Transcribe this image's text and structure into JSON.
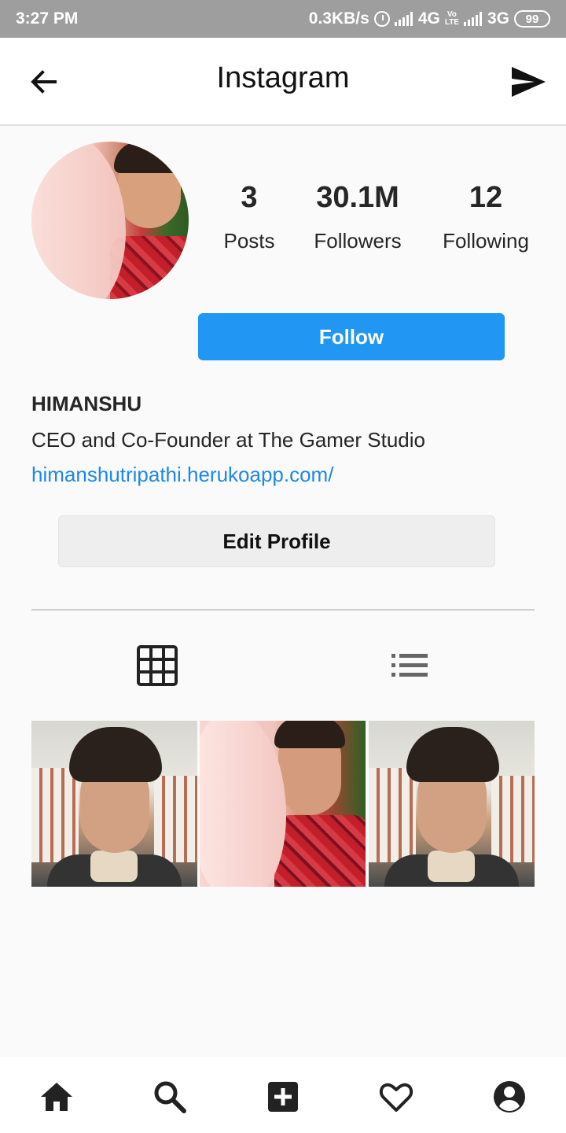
{
  "status_bar": {
    "time": "3:27 PM",
    "net_speed": "0.3KB/s",
    "network1": "4G",
    "volte_top": "Vo",
    "volte_bottom": "LTE",
    "network2": "3G",
    "battery": "99"
  },
  "header": {
    "title": "Instagram"
  },
  "profile": {
    "posts_count": "3",
    "posts_label": "Posts",
    "followers_count": "30.1M",
    "followers_label": "Followers",
    "following_count": "12",
    "following_label": "Following",
    "follow_label": "Follow",
    "name": "HIMANSHU",
    "bio": "CEO and Co-Founder at The Gamer Studio",
    "link": "himanshutripathi.herukoapp.com/",
    "edit_label": "Edit Profile"
  },
  "view_tabs": [
    "grid",
    "list"
  ],
  "posts": [
    {
      "id": 1
    },
    {
      "id": 2
    },
    {
      "id": 3
    }
  ],
  "bottom_nav": [
    "home-icon",
    "search-icon",
    "add-post-icon",
    "heart-icon",
    "profile-icon"
  ],
  "colors": {
    "accent": "#2196f3",
    "link": "#1e88e5",
    "status_bar": "#9e9e9e"
  }
}
